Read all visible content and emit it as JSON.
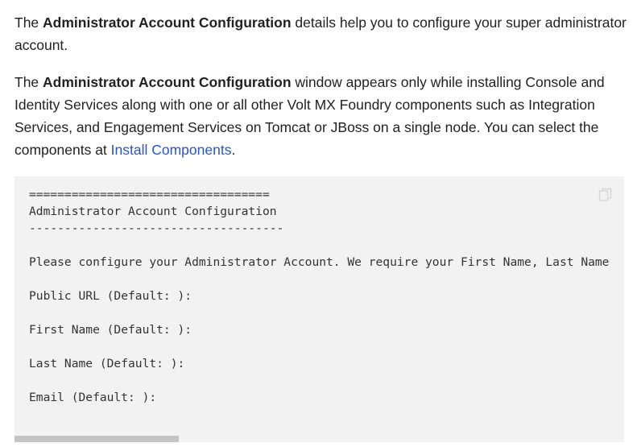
{
  "para1": {
    "prefix": "The ",
    "bold": "Administrator Account Configuration",
    "suffix": " details help you to configure your super administrator account."
  },
  "para2": {
    "prefix": "The ",
    "bold": "Administrator Account Configuration",
    "middle": " window appears only while installing Console and Identity Services along with one or all other Volt MX Foundry components such as Integration Services, and Engagement Services on Tomcat or JBoss on a single node. You can select the components at ",
    "link": "Install Components",
    "end": "."
  },
  "code": {
    "line1": "==================================",
    "line2": "Administrator Account Configuration",
    "line3": "------------------------------------",
    "line4": "Please configure your Administrator Account. We require your First Name, Last Name",
    "line5": "Public URL (Default: ):",
    "line6": "First Name (Default: ):",
    "line7": "Last Name (Default: ):",
    "line8": "Email (Default: ):"
  },
  "icons": {
    "copy": "copy-icon"
  },
  "colors": {
    "link": "#2a55c0",
    "highlight": "#f5ef1a",
    "code_bg": "#f2f2f2"
  }
}
